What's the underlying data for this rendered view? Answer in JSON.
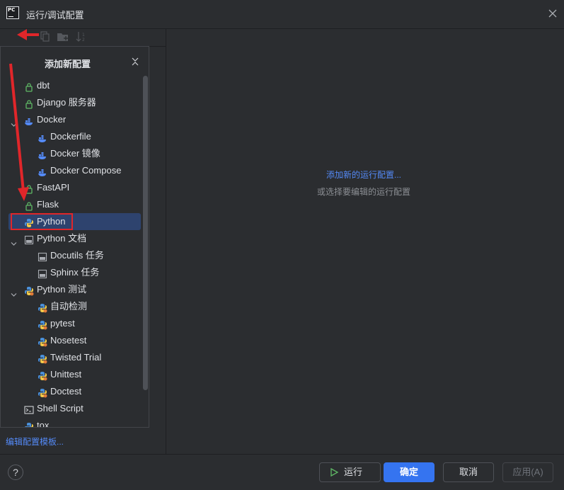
{
  "window": {
    "title": "运行/调试配置"
  },
  "popup": {
    "title": "添加新配置",
    "items": [
      {
        "label": "dbt",
        "icon": "lock-icon",
        "level": 1,
        "chevron": false
      },
      {
        "label": "Django 服务器",
        "icon": "lock-icon",
        "level": 1,
        "chevron": false
      },
      {
        "label": "Docker",
        "icon": "docker-icon",
        "level": 1,
        "chevron": true
      },
      {
        "label": "Dockerfile",
        "icon": "docker-icon",
        "level": 2,
        "chevron": false
      },
      {
        "label": "Docker 镜像",
        "icon": "docker-icon",
        "level": 2,
        "chevron": false
      },
      {
        "label": "Docker Compose",
        "icon": "docker-icon",
        "level": 2,
        "chevron": false
      },
      {
        "label": "FastAPI",
        "icon": "lock-icon",
        "level": 1,
        "chevron": false
      },
      {
        "label": "Flask",
        "icon": "lock-icon",
        "level": 1,
        "chevron": false
      },
      {
        "label": "Python",
        "icon": "python-icon",
        "level": 1,
        "chevron": false,
        "selected": true
      },
      {
        "label": "Python 文档",
        "icon": "rst-icon",
        "level": 1,
        "chevron": true
      },
      {
        "label": "Docutils 任务",
        "icon": "rst-icon",
        "level": 2,
        "chevron": false
      },
      {
        "label": "Sphinx 任务",
        "icon": "rst-icon",
        "level": 2,
        "chevron": false
      },
      {
        "label": "Python 测试",
        "icon": "python-test-icon",
        "level": 1,
        "chevron": true
      },
      {
        "label": "自动检测",
        "icon": "python-test-icon",
        "level": 2,
        "chevron": false
      },
      {
        "label": "pytest",
        "icon": "python-test-icon",
        "level": 2,
        "chevron": false
      },
      {
        "label": "Nosetest",
        "icon": "python-test-icon",
        "level": 2,
        "chevron": false
      },
      {
        "label": "Twisted Trial",
        "icon": "python-test-icon",
        "level": 2,
        "chevron": false
      },
      {
        "label": "Unittest",
        "icon": "python-test-icon",
        "level": 2,
        "chevron": false
      },
      {
        "label": "Doctest",
        "icon": "python-test-icon",
        "level": 2,
        "chevron": false
      },
      {
        "label": "Shell Script",
        "icon": "terminal-icon",
        "level": 1,
        "chevron": false
      },
      {
        "label": "tox",
        "icon": "python-icon",
        "level": 1,
        "chevron": false
      }
    ]
  },
  "left": {
    "templates_link": "编辑配置模板..."
  },
  "main": {
    "add_link": "添加新的运行配置...",
    "hint": "或选择要编辑的运行配置"
  },
  "buttons": {
    "help": "?",
    "run": "运行",
    "ok": "确定",
    "cancel": "取消",
    "apply": "应用(A)"
  },
  "colors": {
    "accent": "#3574f0",
    "link": "#548af7",
    "highlight": "#e0262a",
    "selection": "#2e436e"
  }
}
